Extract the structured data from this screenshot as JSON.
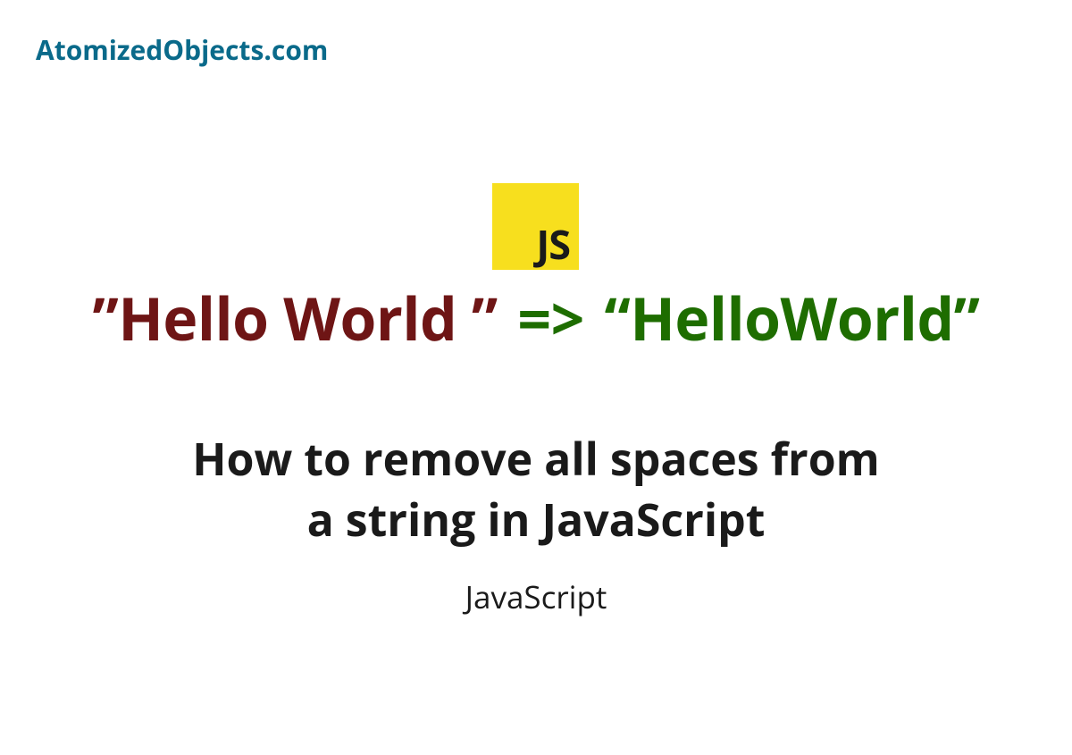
{
  "header": {
    "site_name": "AtomizedObjects.com"
  },
  "badge": {
    "label": "JS"
  },
  "code": {
    "before": "”Hello World ”",
    "arrow": "=>",
    "after": "“HelloWorld”"
  },
  "main": {
    "title_line1": "How to remove all spaces from",
    "title_line2": "a string in JavaScript",
    "category": "JavaScript"
  }
}
